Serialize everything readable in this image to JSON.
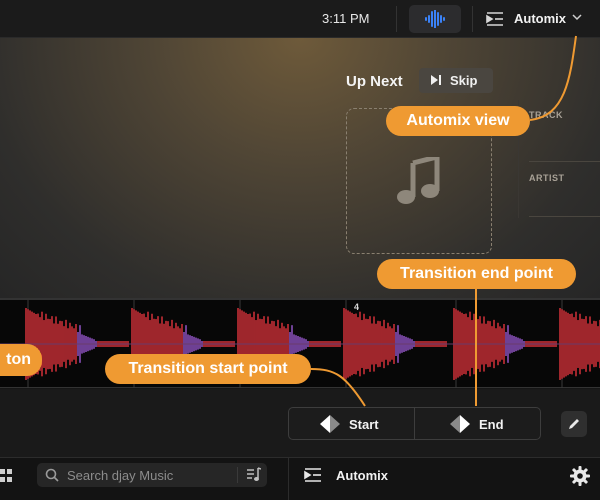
{
  "topbar": {
    "time": "3:11 PM",
    "mode_label": "Automix"
  },
  "up_next": {
    "heading": "Up Next",
    "skip_label": "Skip",
    "track_key": "TRACK",
    "artist_key": "ARTIST"
  },
  "waveform": {
    "beat_marker": "4"
  },
  "transport": {
    "start_label": "Start",
    "end_label": "End"
  },
  "bottombar": {
    "search_placeholder": "Search djay Music",
    "automix_label": "Automix"
  },
  "callouts": {
    "automix_view": "Automix view",
    "transition_end": "Transition end point",
    "transition_start": "Transition start point",
    "partial_left": "ton"
  },
  "colors": {
    "callout": "#ef9a32",
    "waveform_red": "#e0333c",
    "waveform_purple": "#9a5ad2",
    "accent_blue": "#3b82f6"
  }
}
